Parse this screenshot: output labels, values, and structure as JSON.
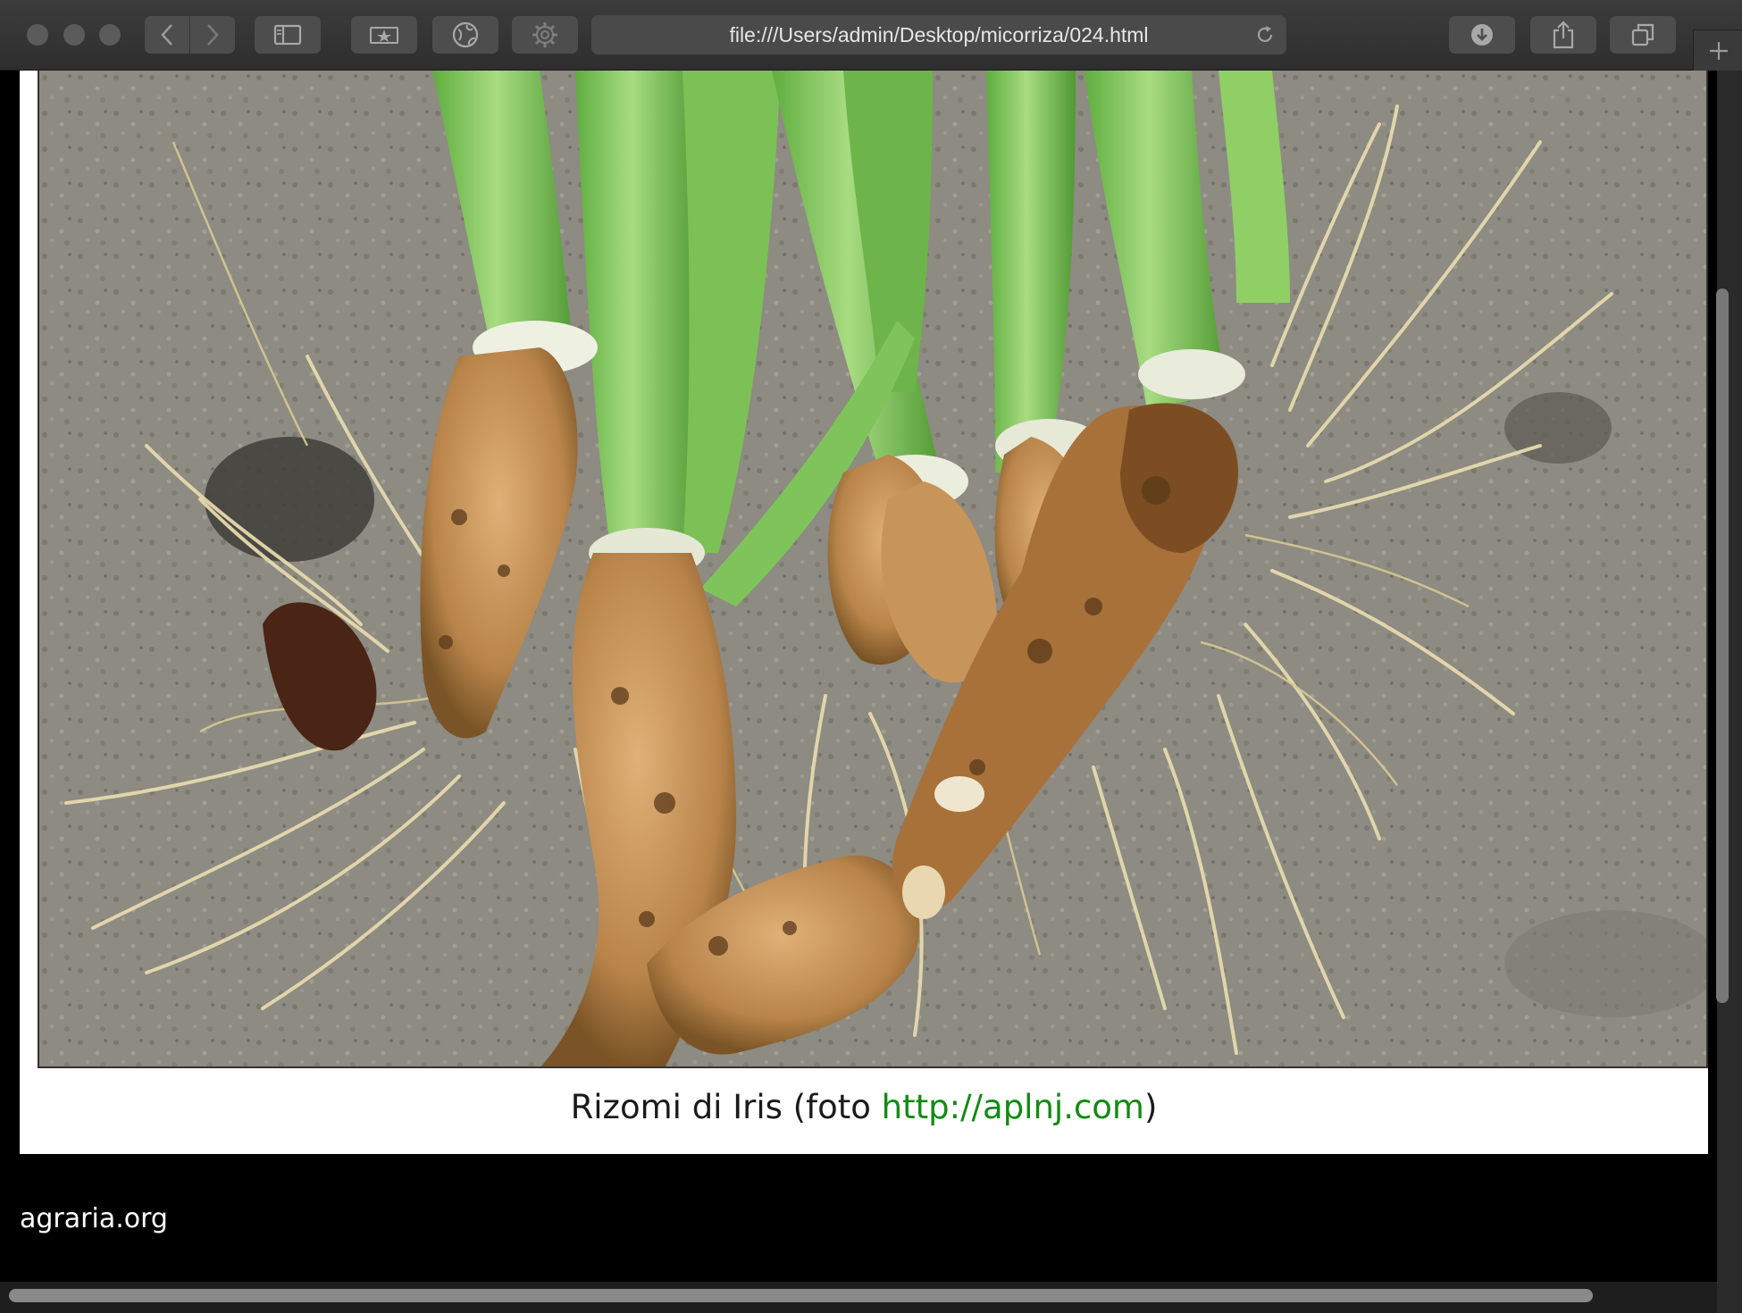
{
  "browser": {
    "address": "file:///Users/admin/Desktop/micorriza/024.html"
  },
  "figure": {
    "caption_prefix": "Rizomi di Iris (foto ",
    "caption_link": "http://aplnj.com",
    "caption_suffix": ")"
  },
  "footer": {
    "site": "agraria.org"
  },
  "colors": {
    "link": "#138a13",
    "page_background": "#000000",
    "figure_background": "#ffffff"
  }
}
